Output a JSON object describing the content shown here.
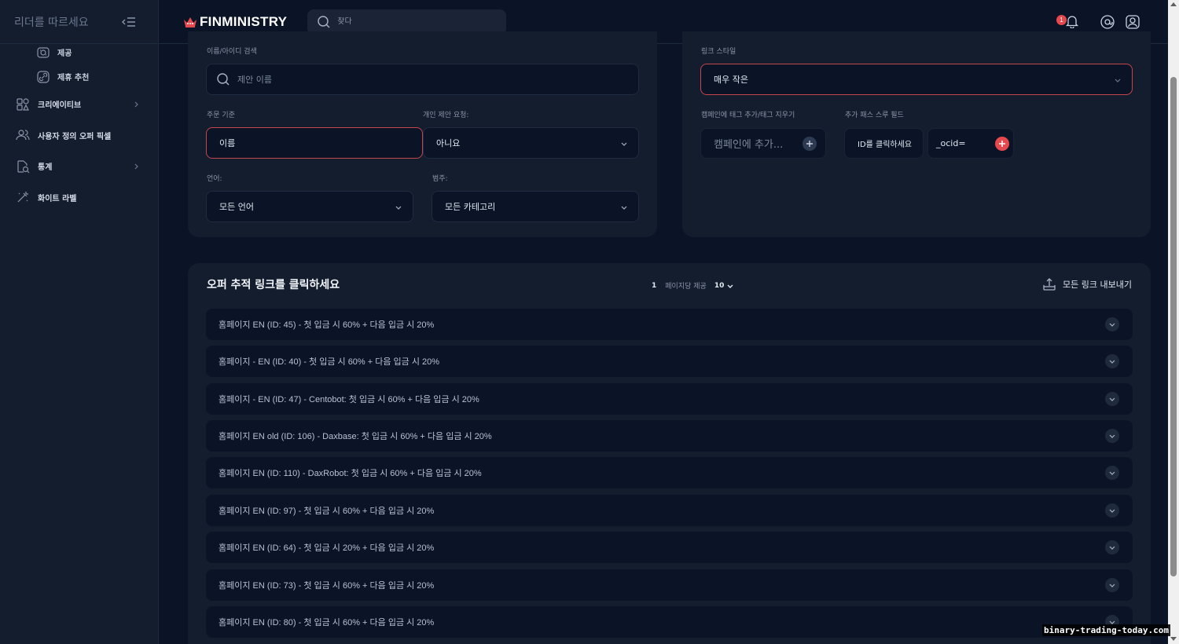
{
  "sidebar": {
    "title": "리더를 따르세요",
    "sub_items": [
      {
        "label": "제공",
        "icon": "offer-icon"
      },
      {
        "label": "제휴 추천",
        "icon": "link-icon"
      }
    ],
    "items": [
      {
        "label": "크리에이티브",
        "icon": "creative-icon",
        "has_chevron": true
      },
      {
        "label": "사용자 정의 오퍼 픽셀",
        "icon": "users-icon",
        "has_chevron": false
      },
      {
        "label": "통계",
        "icon": "stats-icon",
        "has_chevron": true
      },
      {
        "label": "화이트 라벨",
        "icon": "white-label-icon",
        "has_chevron": false
      }
    ]
  },
  "header": {
    "brand": "FINMINISTRY",
    "search_placeholder": "찾다",
    "notification_count": "1"
  },
  "filters": {
    "search_label": "이름/아이디 검색",
    "search_placeholder": "제안 이름",
    "order_label": "주문 기준",
    "order_value": "이름",
    "private_label": "개인 제안 요청:",
    "private_value": "아니요",
    "language_label": "언어:",
    "language_value": "모든 언어",
    "category_label": "범주:",
    "category_value": "모든 카테고리"
  },
  "link_style": {
    "style_label": "링크 스타일",
    "style_value": "매우 작은",
    "campaign_label": "캠페인에 태그 추가/태그 지우기",
    "campaign_placeholder": "캠페인에 추가...",
    "passthrough_label": "추가 패스 스루 필드",
    "passthrough_key": "ID를 클릭하세요",
    "passthrough_value": "_ocid="
  },
  "links": {
    "title": "오퍼 추적 링크를 클릭하세요",
    "page": "1",
    "per_page_label": "페이지당 제공",
    "per_page_value": "10",
    "export_label": "모든 링크 내보내기",
    "rows": [
      "홈페이지 EN (ID: 45) - 첫 입금 시 60% + 다음 입금 시 20%",
      "홈페이지 - EN (ID: 40) - 첫 입금 시 60% + 다음 입금 시 20%",
      "홈페이지 - EN (ID: 47) - Centobot: 첫 입금 시 60% + 다음 입금 시 20%",
      "홈페이지 EN old (ID: 106) - Daxbase: 첫 입금 시 60% + 다음 입금 시 20%",
      "홈페이지 EN (ID: 110) - DaxRobot: 첫 입금 시 60% + 다음 입금 시 20%",
      "홈페이지 EN (ID: 97) - 첫 입금 시 60% + 다음 입금 시 20%",
      "홈페이지 EN (ID: 64) - 첫 입금 시 20% + 다음 입금 시 20%",
      "홈페이지 EN (ID: 73) - 첫 입금 시 60% + 다음 입금 시 20%",
      "홈페이지 EN (ID: 80) - 첫 입금 시 60% + 다음 입금 시 20%"
    ]
  },
  "watermark": "binary-trading-today.com",
  "colors": {
    "background": "#0a1426",
    "panel": "#141d2e",
    "accent_red": "#e5484d",
    "border_red": "#c6464b"
  }
}
